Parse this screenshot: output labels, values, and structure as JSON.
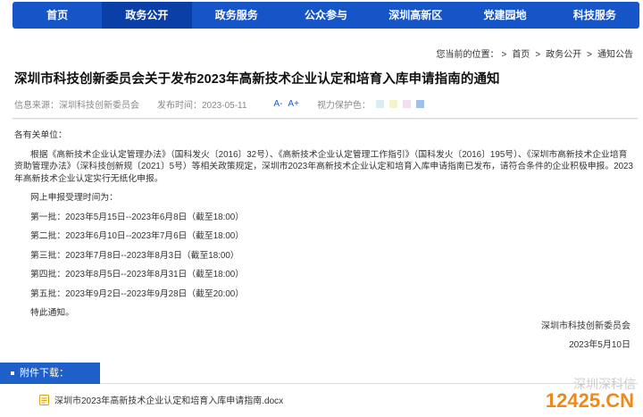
{
  "nav": {
    "items": [
      "首页",
      "政务公开",
      "政务服务",
      "公众参与",
      "深圳高新区",
      "党建园地",
      "科技服务"
    ],
    "active_index": 1
  },
  "breadcrumb": {
    "label": "您当前的位置：",
    "items": [
      "首页",
      "政务公开",
      "通知公告"
    ],
    "separator": ">"
  },
  "article": {
    "title": "深圳市科技创新委员会关于发布2023年高新技术企业认定和培育入库申请指南的通知",
    "source": "信息来源：深圳科技创新委员会",
    "published": "发布时间：2023-05-11",
    "font_smaller": "A-",
    "font_larger": "A+",
    "eye_care_label": "视力保护色：",
    "eye_care_colors": [
      "#d8ecf5",
      "#f5f3c9",
      "#f6dcf0",
      "#9fc0ea"
    ],
    "salutation": "各有关单位：",
    "paragraph": "根据《高新技术企业认定管理办法》（国科发火〔2016〕32号）、《高新技术企业认定管理工作指引》（国科发火〔2016〕195号）、《深圳市高新技术企业培育资助管理办法》（深科技创新规〔2021〕5号）等相关政策规定，深圳市2023年高新技术企业认定和培育入库申请指南已发布，请符合条件的企业积极申报。2023年高新技术企业认定实行无纸化申报。",
    "schedule_intro": "网上申报受理时间为：",
    "batches": [
      "第一批：2023年5月15日--2023年6月8日（截至18:00）",
      "第二批：2023年6月10日--2023年7月6日（截至18:00）",
      "第三批：2023年7月8日--2023年8月3日（截至18:00）",
      "第四批：2023年8月5日--2023年8月31日（截至18:00）",
      "第五批：2023年9月2日--2023年9月28日（截至20:00）"
    ],
    "closing": "特此通知。",
    "signer": "深圳市科技创新委员会",
    "sign_date": "2023年5月10日"
  },
  "attachments": {
    "header": "附件下载：",
    "files": [
      "深圳市2023年高新技术企业认定和培育入库申请指南.docx"
    ]
  },
  "watermark": {
    "top": "深圳深科信",
    "bottom": "12425.CN"
  },
  "colors": {
    "nav_bg": "#1655c8",
    "nav_active": "#0b3fa8",
    "accent": "#1f5fc9",
    "link_blue": "#1a5bd0"
  }
}
